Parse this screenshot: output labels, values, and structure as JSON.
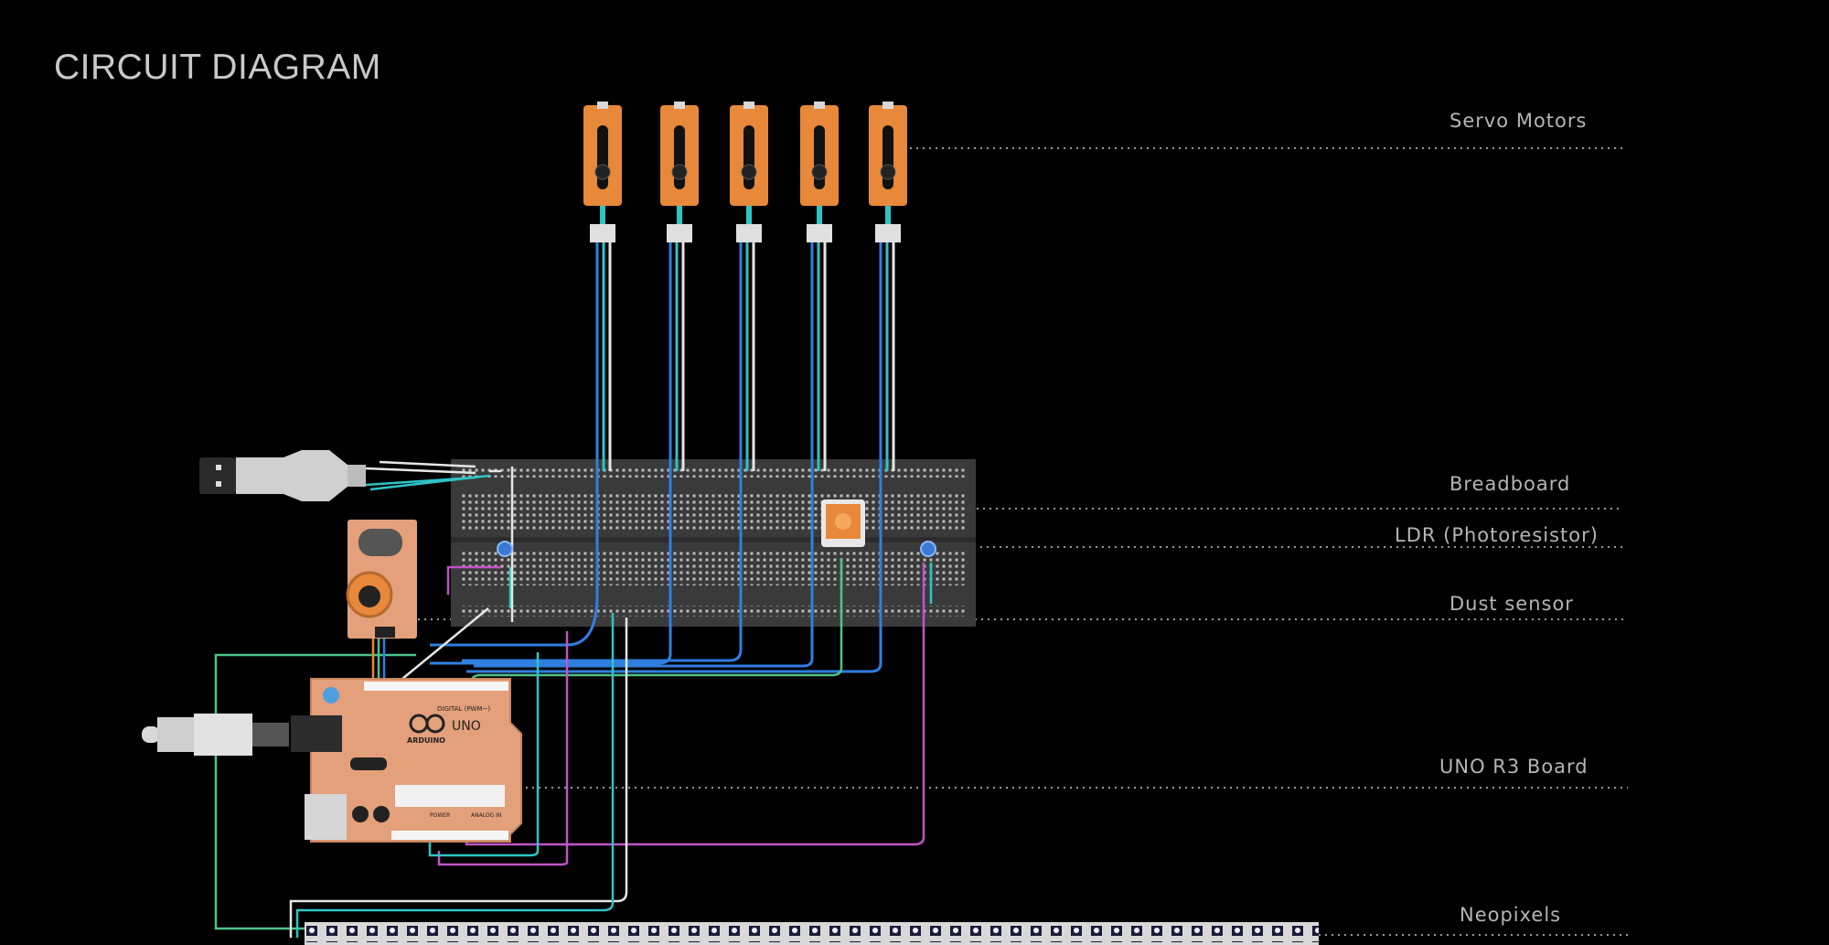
{
  "title": "CIRCUIT DIAGRAM",
  "labels": {
    "servo": "Servo Motors",
    "breadboard": "Breadboard",
    "ldr": "LDR (Photoresistor)",
    "dust": "Dust sensor",
    "uno": "UNO R3 Board",
    "neopixels": "Neopixels"
  },
  "board": {
    "brand": "ARDUINO",
    "model": "UNO",
    "digital": "DIGITAL (PWM~)",
    "power": "POWER",
    "analog": "ANALOG IN"
  },
  "colors": {
    "background": "#000000",
    "servo_orange": "#e8883a",
    "wire_blue": "#2f7fe0",
    "wire_cyan": "#2ec4c4",
    "wire_white": "#e6e6e6",
    "wire_green": "#4fc38a",
    "wire_magenta": "#c253c7",
    "board_copper": "#e3a07a",
    "breadboard": "#3a3a3a"
  },
  "servo_count": 5
}
